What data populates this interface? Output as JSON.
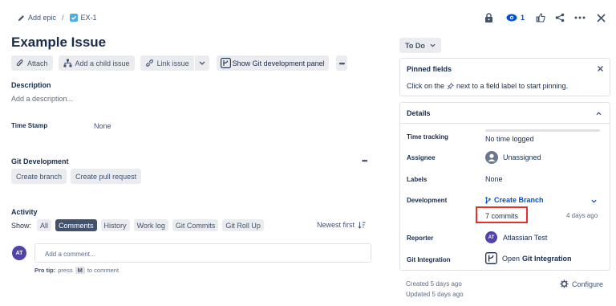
{
  "breadcrumb": {
    "add_epic": "Add epic",
    "separator": "/",
    "issue_key": "EX-1"
  },
  "header_actions": {
    "watch_count": "1"
  },
  "issue": {
    "title": "Example Issue"
  },
  "toolbar": {
    "attach": "Attach",
    "add_child": "Add a child issue",
    "link_issue": "Link issue",
    "git_panel": "Show Git development panel",
    "more": "•••"
  },
  "description": {
    "heading": "Description",
    "placeholder": "Add a description..."
  },
  "time_stamp": {
    "label": "Time Stamp",
    "value": "None"
  },
  "git_dev": {
    "heading": "Git Development",
    "more": "•••",
    "create_branch": "Create branch",
    "create_pr": "Create pull request"
  },
  "activity": {
    "heading": "Activity",
    "show_label": "Show:",
    "filters": [
      "All",
      "Comments",
      "History",
      "Work log",
      "Git Commits",
      "Git Roll Up"
    ],
    "active_filter": "Comments",
    "sort": "Newest first",
    "comment_avatar": "AT",
    "comment_placeholder": "Add a comment...",
    "pro_tip_prefix": "Pro tip:",
    "pro_tip_press": "press",
    "pro_tip_key": "M",
    "pro_tip_suffix": "to comment"
  },
  "status": {
    "label": "To Do"
  },
  "pinned": {
    "heading": "Pinned fields",
    "text_before": "Click on the",
    "text_after": "next to a field label to start pinning."
  },
  "details": {
    "heading": "Details",
    "time_tracking_label": "Time tracking",
    "time_tracking_value": "No time logged",
    "assignee_label": "Assignee",
    "assignee_value": "Unassigned",
    "labels_label": "Labels",
    "labels_value": "None",
    "development_label": "Development",
    "create_branch": "Create Branch",
    "commits": "7 commits",
    "commits_time": "4 days ago",
    "reporter_label": "Reporter",
    "reporter_avatar": "AT",
    "reporter_value": "Atlassian Test",
    "git_integration_label": "Git Integration",
    "git_integration_open": "Open",
    "git_integration_value": "Git Integration"
  },
  "footer": {
    "created": "Created 5 days ago",
    "updated": "Updated 5 days ago",
    "configure": "Configure"
  },
  "colors": {
    "accent": "#0052cc",
    "highlight": "#e5312b",
    "avatar": "#5243aa",
    "text": "#172b4d"
  }
}
